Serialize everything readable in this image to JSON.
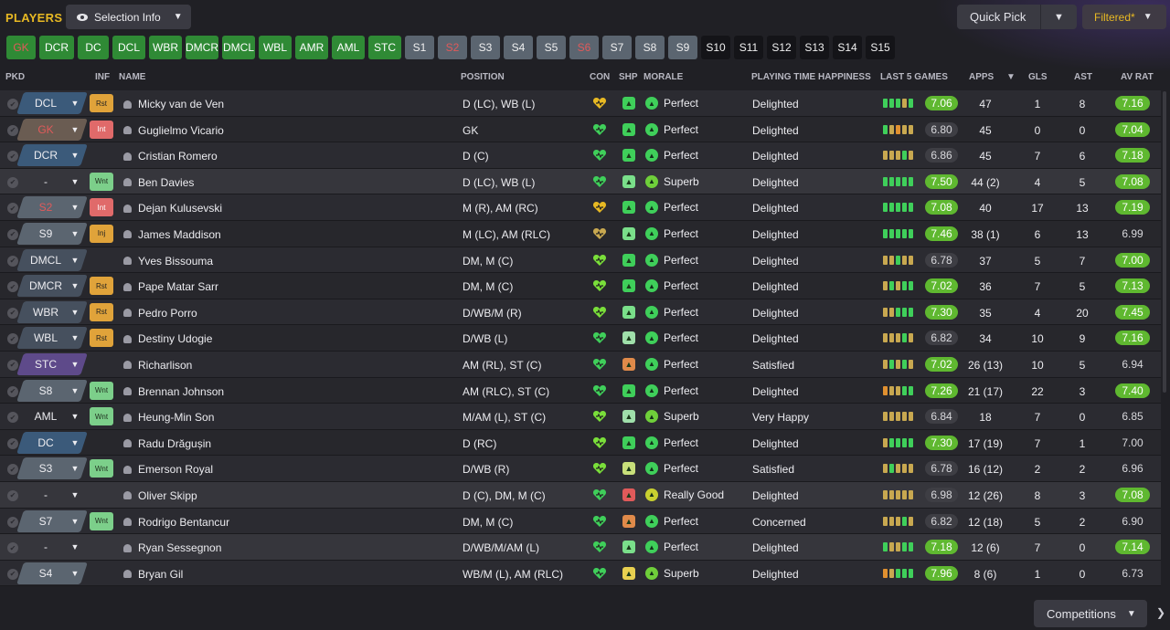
{
  "header": {
    "title": "PLAYERS",
    "selection_info": "Selection Info",
    "quick_pick": "Quick Pick",
    "filtered": "Filtered*"
  },
  "position_buttons": [
    {
      "label": "GK",
      "style": "gr"
    },
    {
      "label": "DCR",
      "style": "g"
    },
    {
      "label": "DC",
      "style": "g"
    },
    {
      "label": "DCL",
      "style": "g"
    },
    {
      "label": "WBR",
      "style": "g"
    },
    {
      "label": "DMCR",
      "style": "g"
    },
    {
      "label": "DMCL",
      "style": "g"
    },
    {
      "label": "WBL",
      "style": "g"
    },
    {
      "label": "AMR",
      "style": "g"
    },
    {
      "label": "AML",
      "style": "g"
    },
    {
      "label": "STC",
      "style": "g"
    },
    {
      "label": "S1",
      "style": "s"
    },
    {
      "label": "S2",
      "style": "sr"
    },
    {
      "label": "S3",
      "style": "s"
    },
    {
      "label": "S4",
      "style": "s"
    },
    {
      "label": "S5",
      "style": "s"
    },
    {
      "label": "S6",
      "style": "sr"
    },
    {
      "label": "S7",
      "style": "s"
    },
    {
      "label": "S8",
      "style": "s"
    },
    {
      "label": "S9",
      "style": "s"
    },
    {
      "label": "S10",
      "style": "k"
    },
    {
      "label": "S11",
      "style": "k"
    },
    {
      "label": "S12",
      "style": "k"
    },
    {
      "label": "S13",
      "style": "k"
    },
    {
      "label": "S14",
      "style": "k"
    },
    {
      "label": "S15",
      "style": "k"
    }
  ],
  "columns": {
    "pkd": "PKD",
    "inf": "INF",
    "name": "NAME",
    "position": "POSITION",
    "con": "CON",
    "shp": "SHP",
    "morale": "MORALE",
    "pth": "PLAYING TIME HAPPINESS",
    "last5": "LAST 5 GAMES",
    "apps": "APPS",
    "gls": "GLS",
    "ast": "AST",
    "avrat": "AV RAT"
  },
  "players": [
    {
      "sel": "DCL",
      "selstyle": "dc",
      "inf": "Rst",
      "name": "Micky van de Ven",
      "position": "D (LC), WB (L)",
      "con": "#e8b923",
      "shp": "#3fcf5a",
      "morale": "Perfect",
      "mcol": "#3fcf5a",
      "pth": "Delighted",
      "l5": [
        "#3fcf5a",
        "#3fcf5a",
        "#3fcf5a",
        "#c8a850",
        "#3fcf5a"
      ],
      "rating": "7.06",
      "rgood": true,
      "apps": "47",
      "gls": "1",
      "ast": "8",
      "avrat": "7.16",
      "agood": true
    },
    {
      "sel": "GK",
      "selstyle": "gk",
      "red": true,
      "inf": "Int",
      "name": "Guglielmo Vicario",
      "position": "GK",
      "con": "#3fcf5a",
      "shp": "#3fcf5a",
      "morale": "Perfect",
      "mcol": "#3fcf5a",
      "pth": "Delighted",
      "l5": [
        "#3fcf5a",
        "#c8a850",
        "#e09030",
        "#c8a850",
        "#c8a850"
      ],
      "rating": "6.80",
      "rgood": false,
      "apps": "45",
      "gls": "0",
      "ast": "0",
      "avrat": "7.04",
      "agood": true
    },
    {
      "sel": "DCR",
      "selstyle": "dc",
      "inf": "",
      "name": "Cristian Romero",
      "position": "D (C)",
      "con": "#3fcf5a",
      "shp": "#3fcf5a",
      "morale": "Perfect",
      "mcol": "#3fcf5a",
      "pth": "Delighted",
      "l5": [
        "#c8a850",
        "#c8a850",
        "#c8a850",
        "#3fcf5a",
        "#c8a850"
      ],
      "rating": "6.86",
      "rgood": false,
      "apps": "45",
      "gls": "7",
      "ast": "6",
      "avrat": "7.18",
      "agood": true
    },
    {
      "sel": "-",
      "selstyle": "none",
      "inf": "Wnt",
      "name": "Ben Davies",
      "position": "D (LC), WB (L)",
      "con": "#3fcf5a",
      "shp": "#7adf8a",
      "morale": "Superb",
      "mcol": "#6fcf3a",
      "pth": "Delighted",
      "l5": [
        "#3fcf5a",
        "#3fcf5a",
        "#3fcf5a",
        "#3fcf5a",
        "#3fcf5a"
      ],
      "rating": "7.50",
      "rgood": true,
      "apps": "44 (2)",
      "gls": "4",
      "ast": "5",
      "avrat": "7.08",
      "agood": true
    },
    {
      "sel": "S2",
      "selstyle": "sub",
      "red": true,
      "inf": "Int",
      "name": "Dejan Kulusevski",
      "position": "M (R), AM (RC)",
      "con": "#e8b923",
      "shp": "#3fcf5a",
      "morale": "Perfect",
      "mcol": "#3fcf5a",
      "pth": "Delighted",
      "l5": [
        "#3fcf5a",
        "#3fcf5a",
        "#3fcf5a",
        "#3fcf5a",
        "#3fcf5a"
      ],
      "rating": "7.08",
      "rgood": true,
      "apps": "40",
      "gls": "17",
      "ast": "13",
      "avrat": "7.19",
      "agood": true
    },
    {
      "sel": "S9",
      "selstyle": "sub",
      "inf": "Inj",
      "name": "James Maddison",
      "position": "M (LC), AM (RLC)",
      "con": "#c8a850",
      "shp": "#7adf8a",
      "morale": "Perfect",
      "mcol": "#3fcf5a",
      "pth": "Delighted",
      "l5": [
        "#3fcf5a",
        "#3fcf5a",
        "#3fcf5a",
        "#3fcf5a",
        "#3fcf5a"
      ],
      "rating": "7.46",
      "rgood": true,
      "apps": "38 (1)",
      "gls": "6",
      "ast": "13",
      "avrat": "6.99",
      "agood": false
    },
    {
      "sel": "DMCL",
      "selstyle": "def",
      "inf": "",
      "name": "Yves Bissouma",
      "position": "DM, M (C)",
      "con": "#7adf3a",
      "shp": "#3fcf5a",
      "morale": "Perfect",
      "mcol": "#3fcf5a",
      "pth": "Delighted",
      "l5": [
        "#c8a850",
        "#c8a850",
        "#3fcf5a",
        "#c8a850",
        "#c8a850"
      ],
      "rating": "6.78",
      "rgood": false,
      "apps": "37",
      "gls": "5",
      "ast": "7",
      "avrat": "7.00",
      "agood": true
    },
    {
      "sel": "DMCR",
      "selstyle": "def",
      "inf": "Rst",
      "name": "Pape Matar Sarr",
      "position": "DM, M (C)",
      "con": "#7adf3a",
      "shp": "#3fcf5a",
      "morale": "Perfect",
      "mcol": "#3fcf5a",
      "pth": "Delighted",
      "l5": [
        "#c8a850",
        "#3fcf5a",
        "#c8a850",
        "#3fcf5a",
        "#3fcf5a"
      ],
      "rating": "7.02",
      "rgood": true,
      "apps": "36",
      "gls": "7",
      "ast": "5",
      "avrat": "7.13",
      "agood": true
    },
    {
      "sel": "WBR",
      "selstyle": "def",
      "inf": "Rst",
      "name": "Pedro Porro",
      "position": "D/WB/M (R)",
      "con": "#7adf3a",
      "shp": "#7adf8a",
      "morale": "Perfect",
      "mcol": "#3fcf5a",
      "pth": "Delighted",
      "l5": [
        "#c8a850",
        "#c8a850",
        "#3fcf5a",
        "#3fcf5a",
        "#3fcf5a"
      ],
      "rating": "7.30",
      "rgood": true,
      "apps": "35",
      "gls": "4",
      "ast": "20",
      "avrat": "7.45",
      "agood": true
    },
    {
      "sel": "WBL",
      "selstyle": "def",
      "inf": "Rst",
      "name": "Destiny Udogie",
      "position": "D/WB (L)",
      "con": "#3fcf5a",
      "shp": "#9fdfaa",
      "morale": "Perfect",
      "mcol": "#3fcf5a",
      "pth": "Delighted",
      "l5": [
        "#c8a850",
        "#c8a850",
        "#c8a850",
        "#3fcf5a",
        "#c8a850"
      ],
      "rating": "6.82",
      "rgood": false,
      "apps": "34",
      "gls": "10",
      "ast": "9",
      "avrat": "7.16",
      "agood": true
    },
    {
      "sel": "STC",
      "selstyle": "stc",
      "inf": "",
      "name": "Richarlison",
      "position": "AM (RL), ST (C)",
      "con": "#3fcf5a",
      "shp": "#e08a4a",
      "morale": "Perfect",
      "mcol": "#3fcf5a",
      "pth": "Satisfied",
      "l5": [
        "#c8a850",
        "#3fcf5a",
        "#c8a850",
        "#3fcf5a",
        "#c8a850"
      ],
      "rating": "7.02",
      "rgood": true,
      "apps": "26 (13)",
      "gls": "10",
      "ast": "5",
      "avrat": "6.94",
      "agood": false
    },
    {
      "sel": "S8",
      "selstyle": "sub",
      "inf": "Wnt",
      "name": "Brennan Johnson",
      "position": "AM (RLC), ST (C)",
      "con": "#3fcf5a",
      "shp": "#3fcf5a",
      "morale": "Perfect",
      "mcol": "#3fcf5a",
      "pth": "Delighted",
      "l5": [
        "#e09030",
        "#c8a850",
        "#c8a850",
        "#3fcf5a",
        "#3fcf5a"
      ],
      "rating": "7.26",
      "rgood": true,
      "apps": "21 (17)",
      "gls": "22",
      "ast": "3",
      "avrat": "7.40",
      "agood": true
    },
    {
      "sel": "AML",
      "selstyle": "none",
      "inf": "Wnt",
      "name": "Heung-Min Son",
      "position": "M/AM (L), ST (C)",
      "con": "#7adf3a",
      "shp": "#9fdfaa",
      "morale": "Superb",
      "mcol": "#6fcf3a",
      "pth": "Very Happy",
      "l5": [
        "#c8a850",
        "#c8a850",
        "#c8a850",
        "#c8a850",
        "#c8a850"
      ],
      "rating": "6.84",
      "rgood": false,
      "apps": "18",
      "gls": "7",
      "ast": "0",
      "avrat": "6.85",
      "agood": false
    },
    {
      "sel": "DC",
      "selstyle": "dc",
      "inf": "",
      "name": "Radu Drăgușin",
      "position": "D (RC)",
      "con": "#7adf3a",
      "shp": "#3fcf5a",
      "morale": "Perfect",
      "mcol": "#3fcf5a",
      "pth": "Delighted",
      "l5": [
        "#c8a850",
        "#3fcf5a",
        "#3fcf5a",
        "#3fcf5a",
        "#3fcf5a"
      ],
      "rating": "7.30",
      "rgood": true,
      "apps": "17 (19)",
      "gls": "7",
      "ast": "1",
      "avrat": "7.00",
      "agood": false
    },
    {
      "sel": "S3",
      "selstyle": "sub",
      "inf": "Wnt",
      "name": "Emerson Royal",
      "position": "D/WB (R)",
      "con": "#7adf3a",
      "shp": "#c8df7a",
      "morale": "Perfect",
      "mcol": "#3fcf5a",
      "pth": "Satisfied",
      "l5": [
        "#c8a850",
        "#3fcf5a",
        "#c8a850",
        "#c8a850",
        "#c8a850"
      ],
      "rating": "6.78",
      "rgood": false,
      "apps": "16 (12)",
      "gls": "2",
      "ast": "2",
      "avrat": "6.96",
      "agood": false
    },
    {
      "sel": "-",
      "selstyle": "none",
      "inf": "",
      "name": "Oliver Skipp",
      "position": "D (C), DM, M (C)",
      "con": "#3fcf5a",
      "shp": "#e05a5a",
      "morale": "Really Good",
      "mcol": "#c8d030",
      "pth": "Delighted",
      "l5": [
        "#c8a850",
        "#c8a850",
        "#c8a850",
        "#c8a850",
        "#c8a850"
      ],
      "rating": "6.98",
      "rgood": false,
      "apps": "12 (26)",
      "gls": "8",
      "ast": "3",
      "avrat": "7.08",
      "agood": true
    },
    {
      "sel": "S7",
      "selstyle": "sub",
      "inf": "Wnt",
      "name": "Rodrigo Bentancur",
      "position": "DM, M (C)",
      "con": "#3fcf5a",
      "shp": "#e08a4a",
      "morale": "Perfect",
      "mcol": "#3fcf5a",
      "pth": "Concerned",
      "l5": [
        "#c8a850",
        "#c8a850",
        "#c8a850",
        "#3fcf5a",
        "#c8a850"
      ],
      "rating": "6.82",
      "rgood": false,
      "apps": "12 (18)",
      "gls": "5",
      "ast": "2",
      "avrat": "6.90",
      "agood": false
    },
    {
      "sel": "-",
      "selstyle": "none",
      "inf": "",
      "name": "Ryan Sessegnon",
      "position": "D/WB/M/AM (L)",
      "con": "#3fcf5a",
      "shp": "#7adf8a",
      "morale": "Perfect",
      "mcol": "#3fcf5a",
      "pth": "Delighted",
      "l5": [
        "#3fcf5a",
        "#c8a850",
        "#c8a850",
        "#3fcf5a",
        "#3fcf5a"
      ],
      "rating": "7.18",
      "rgood": true,
      "apps": "12 (6)",
      "gls": "7",
      "ast": "0",
      "avrat": "7.14",
      "agood": true
    },
    {
      "sel": "S4",
      "selstyle": "sub",
      "inf": "",
      "name": "Bryan Gil",
      "position": "WB/M (L), AM (RLC)",
      "con": "#3fcf5a",
      "shp": "#e8d050",
      "morale": "Superb",
      "mcol": "#6fcf3a",
      "pth": "Delighted",
      "l5": [
        "#e09030",
        "#c8a850",
        "#3fcf5a",
        "#3fcf5a",
        "#3fcf5a"
      ],
      "rating": "7.96",
      "rgood": true,
      "apps": "8 (6)",
      "gls": "1",
      "ast": "0",
      "avrat": "6.73",
      "agood": false
    }
  ],
  "footer": {
    "competitions": "Competitions"
  }
}
